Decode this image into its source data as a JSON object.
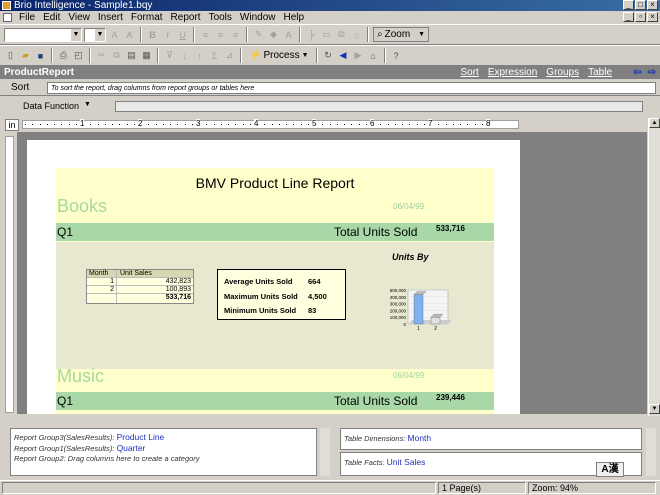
{
  "window": {
    "title": "Brio Intelligence - Sample1.bqy"
  },
  "menu": [
    "File",
    "Edit",
    "View",
    "Insert",
    "Format",
    "Report",
    "Tools",
    "Window",
    "Help"
  ],
  "toolbar": {
    "process_label": "Process",
    "zoom_label": "Zoom"
  },
  "section": {
    "name": "ProductReport",
    "links": [
      "Sort",
      "Expression",
      "Groups",
      "Table"
    ]
  },
  "sort": {
    "label": "Sort",
    "placeholder": "To sort the report, drag columns from report groups or tables here"
  },
  "data_function": {
    "label": "Data Function"
  },
  "ruler": {
    "unit": "in",
    "ticks": [
      "1",
      "2",
      "3",
      "4",
      "5",
      "6",
      "7",
      "8"
    ]
  },
  "report": {
    "title": "BMV Product Line Report",
    "groups": [
      {
        "name": "Books",
        "date": "06/04/99",
        "quarter": "Q1",
        "total_label": "Total Units Sold",
        "total_value": "533,716"
      },
      {
        "name": "Music",
        "date": "06/04/99",
        "quarter": "Q1",
        "total_label": "Total Units Sold",
        "total_value": "239,446"
      }
    ],
    "sales_table": {
      "headers": [
        "Month",
        "Unit Sales"
      ],
      "rows": [
        [
          "1",
          "432,823"
        ],
        [
          "2",
          "100,893"
        ],
        [
          "",
          "533,716"
        ]
      ]
    },
    "stats": [
      {
        "label": "Average Units Sold",
        "value": "664"
      },
      {
        "label": "Maximum Units Sold",
        "value": "4,500"
      },
      {
        "label": "Minimum Units Sold",
        "value": "83"
      }
    ]
  },
  "chart_data": {
    "type": "bar",
    "title": "Units By",
    "categories": [
      "1",
      "2"
    ],
    "values": [
      432823,
      100893
    ],
    "ylim": [
      0,
      500000
    ],
    "yticks": [
      "500,000",
      "400,000",
      "300,000",
      "200,000",
      "100,000",
      "0"
    ]
  },
  "bottom": {
    "groups": [
      {
        "label": "Report Group3(SalesResults):",
        "value": "Product Line"
      },
      {
        "label": "Report Group1(SalesResults):",
        "value": "Quarter"
      },
      {
        "label": "Report Group2:",
        "value": "Drag columns here to create a category"
      }
    ],
    "table_dimensions": {
      "label": "Table Dimensions:",
      "value": "Month"
    },
    "table_facts": {
      "label": "Table Facts:",
      "value": "Unit Sales"
    }
  },
  "status": {
    "pages": "1 Page(s)",
    "zoom": "Zoom: 94%"
  },
  "ime": "A漢"
}
